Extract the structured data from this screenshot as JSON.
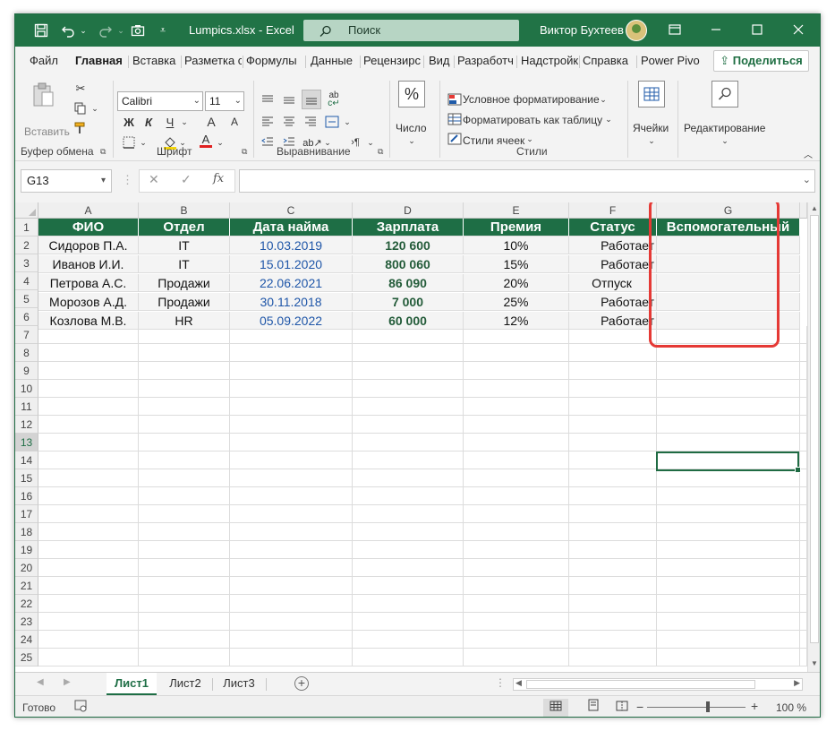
{
  "window": {
    "title": "Lumpics.xlsx  -  Excel",
    "search_placeholder": "Поиск",
    "user_name": "Виктор Бухтеев",
    "undo_icon": "undo-icon",
    "accent_color": "#217346"
  },
  "tabs": [
    "Файл",
    "Главная",
    "Вставка",
    "Разметка с",
    "Формулы",
    "Данные",
    "Рецензирс",
    "Вид",
    "Разработч",
    "Надстройк",
    "Справка",
    "Power Pivo"
  ],
  "active_tab": "Главная",
  "share_label": "Поделиться",
  "ribbon": {
    "clipboard": {
      "paste_label": "Вставить",
      "group_label": "Буфер обмена"
    },
    "font": {
      "font_name": "Calibri",
      "font_size": "11",
      "bold": "Ж",
      "italic": "К",
      "underline": "Ч",
      "grow": "A",
      "shrink": "A",
      "group_label": "Шрифт"
    },
    "alignment": {
      "group_label": "Выравнивание"
    },
    "number": {
      "label": "Число",
      "symbol": "%"
    },
    "styles": {
      "cond_format": "Условное форматирование",
      "format_table": "Форматировать как таблицу",
      "cell_styles": "Стили ячеек",
      "group_label": "Стили"
    },
    "cells": {
      "label": "Ячейки"
    },
    "editing": {
      "label": "Редактирование"
    }
  },
  "formula_bar": {
    "name_box": "G13",
    "fx": "fx",
    "formula": ""
  },
  "sheet": {
    "columns": [
      "A",
      "B",
      "C",
      "D",
      "E",
      "F",
      "G"
    ],
    "row_numbers": [
      "1",
      "2",
      "3",
      "4",
      "5",
      "6",
      "7",
      "8",
      "9",
      "10",
      "11",
      "12",
      "13",
      "14",
      "15",
      "16",
      "17",
      "18",
      "19",
      "20",
      "21",
      "22",
      "23",
      "24",
      "25"
    ],
    "header_row": [
      "ФИО",
      "Отдел",
      "Дата найма",
      "Зарплата",
      "Премия",
      "Статус",
      "Вспомогательный"
    ],
    "rows": [
      [
        "Сидоров П.А.",
        "IT",
        "10.03.2019",
        "120 600",
        "10%",
        "Работает",
        ""
      ],
      [
        "Иванов И.И.",
        "IT",
        "15.01.2020",
        "800 060",
        "15%",
        "Работает",
        ""
      ],
      [
        "Петрова А.С.",
        "Продажи",
        "22.06.2021",
        "86 090",
        "20%",
        "Отпуск",
        ""
      ],
      [
        "Морозов А.Д.",
        "Продажи",
        "30.11.2018",
        "7 000",
        "25%",
        "Работает",
        ""
      ],
      [
        "Козлова М.В.",
        "HR",
        "05.09.2022",
        "60 000",
        "12%",
        "Работает",
        ""
      ]
    ],
    "selected_cell": "G13",
    "highlight_color": "#e53935"
  },
  "sheet_tabs": [
    "Лист1",
    "Лист2",
    "Лист3"
  ],
  "active_sheet": "Лист1",
  "status": {
    "ready": "Готово",
    "zoom": "100 %"
  }
}
